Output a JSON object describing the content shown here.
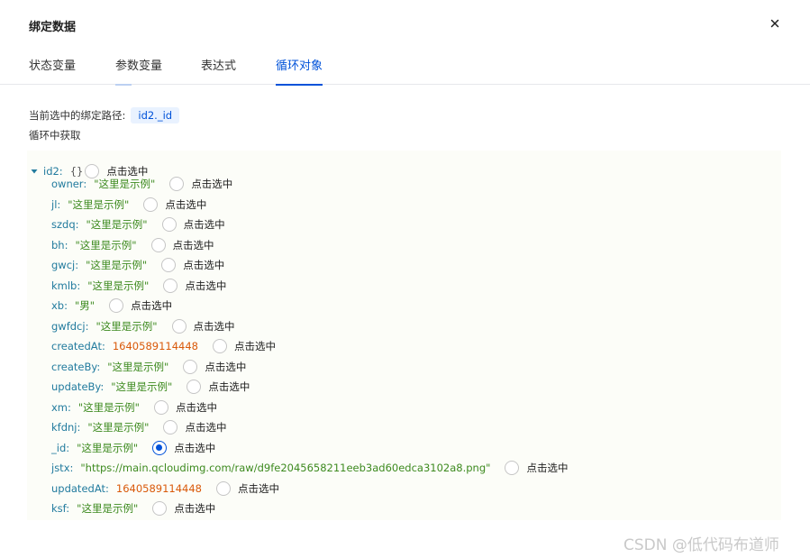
{
  "dialog": {
    "title": "绑定数据",
    "close_icon": "close-icon"
  },
  "tabs": [
    {
      "label": "状态变量",
      "state": "normal"
    },
    {
      "label": "参数变量",
      "state": "hover"
    },
    {
      "label": "表达式",
      "state": "normal"
    },
    {
      "label": "循环对象",
      "state": "active"
    }
  ],
  "binding": {
    "path_label": "当前选中的绑定路径:",
    "path_value": "id2._id",
    "loop_note": "循环中获取"
  },
  "tree": {
    "root": {
      "key": "id2:",
      "brace": "{}",
      "select_label": "点击选中",
      "expanded": true
    },
    "select_label": "点击选中",
    "items": [
      {
        "key": "owner:",
        "value": "\"这里是示例\"",
        "type": "string",
        "selected": false
      },
      {
        "key": "jl:",
        "value": "\"这里是示例\"",
        "type": "string",
        "selected": false
      },
      {
        "key": "szdq:",
        "value": "\"这里是示例\"",
        "type": "string",
        "selected": false
      },
      {
        "key": "bh:",
        "value": "\"这里是示例\"",
        "type": "string",
        "selected": false
      },
      {
        "key": "gwcj:",
        "value": "\"这里是示例\"",
        "type": "string",
        "selected": false
      },
      {
        "key": "kmlb:",
        "value": "\"这里是示例\"",
        "type": "string",
        "selected": false
      },
      {
        "key": "xb:",
        "value": "\"男\"",
        "type": "string",
        "selected": false
      },
      {
        "key": "gwfdcj:",
        "value": "\"这里是示例\"",
        "type": "string",
        "selected": false
      },
      {
        "key": "createdAt:",
        "value": "1640589114448",
        "type": "number",
        "selected": false
      },
      {
        "key": "createBy:",
        "value": "\"这里是示例\"",
        "type": "string",
        "selected": false
      },
      {
        "key": "updateBy:",
        "value": "\"这里是示例\"",
        "type": "string",
        "selected": false
      },
      {
        "key": "xm:",
        "value": "\"这里是示例\"",
        "type": "string",
        "selected": false
      },
      {
        "key": "kfdnj:",
        "value": "\"这里是示例\"",
        "type": "string",
        "selected": false
      },
      {
        "key": "_id:",
        "value": "\"这里是示例\"",
        "type": "string",
        "selected": true
      },
      {
        "key": "jstx:",
        "value": "\"https://main.qcloudimg.com/raw/d9fe2045658211eeb3ad60edca3102a8.png\"",
        "type": "string",
        "selected": false
      },
      {
        "key": "updatedAt:",
        "value": "1640589114448",
        "type": "number",
        "selected": false
      },
      {
        "key": "ksf:",
        "value": "\"这里是示例\"",
        "type": "string",
        "selected": false
      }
    ]
  },
  "watermark": "CSDN @低代码布道师",
  "colors": {
    "accent": "#0052d9",
    "key": "#227b9e",
    "string": "#3d8a1f",
    "number": "#d9590a"
  }
}
